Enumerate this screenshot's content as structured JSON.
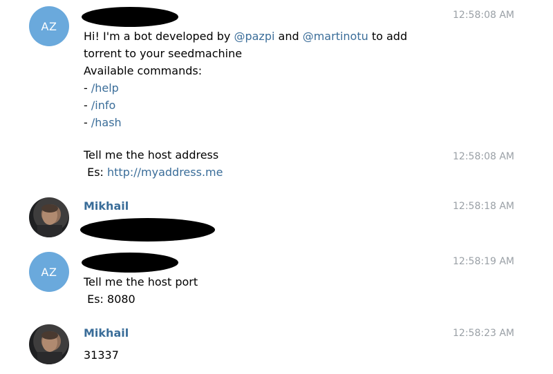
{
  "theme": {
    "avatar_bg": "#6aa9dc",
    "link_color": "#3a6d99"
  },
  "messages": [
    {
      "avatar_initials": "AZ",
      "time": "12:58:08 AM",
      "intro": {
        "pre": "Hi! I'm a bot developed by ",
        "user1": "@pazpi",
        "mid": " and ",
        "user2": "@martinotu",
        "post": " to add"
      },
      "line2": "torrent to your seedmachine",
      "line3": "Available commands:",
      "dash": "- ",
      "cmd_help": "/help",
      "cmd_info": "/info",
      "cmd_hash": "/hash"
    },
    {
      "time": "12:58:08 AM",
      "line1": "Tell me the host address",
      "es_prefix": " Es: ",
      "es_link": "http://myaddress.me"
    },
    {
      "avatar_icon": "user-photo-icon",
      "sender": "Mikhail",
      "time": "12:58:18 AM"
    },
    {
      "avatar_initials": "AZ",
      "time": "12:58:19 AM",
      "line1": "Tell me the host port",
      "line2": " Es: 8080"
    },
    {
      "avatar_icon": "user-photo-icon",
      "sender": "Mikhail",
      "time": "12:58:23 AM",
      "text": "31337"
    }
  ]
}
